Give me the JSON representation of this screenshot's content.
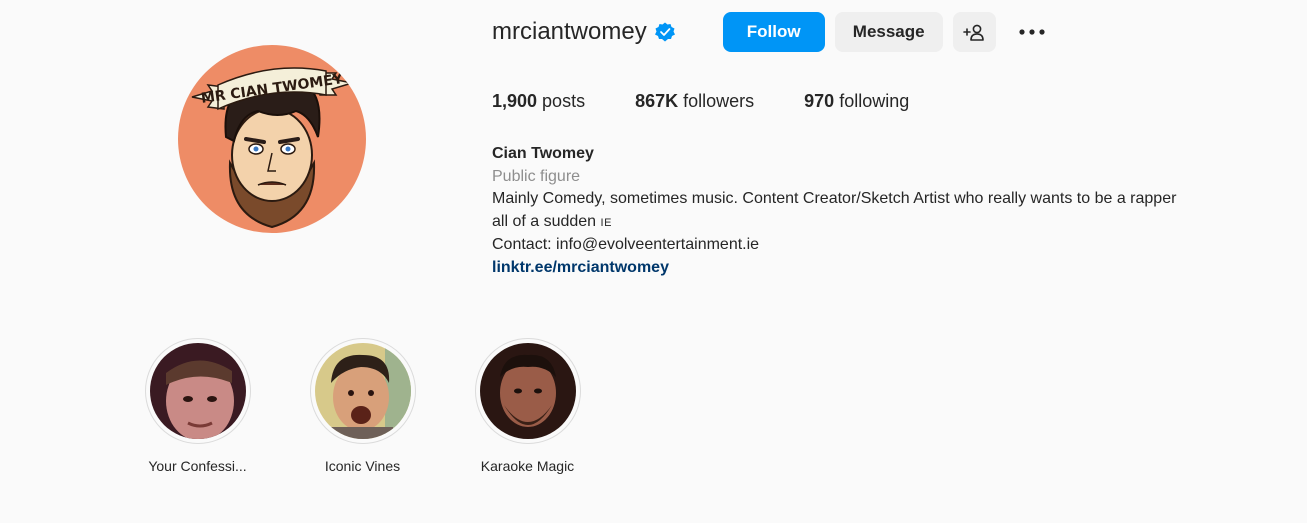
{
  "profile": {
    "username": "mrciantwomey",
    "verified": true,
    "avatar_banner_text": "MR CIAN TWOMEY"
  },
  "actions": {
    "follow_label": "Follow",
    "message_label": "Message",
    "suggest_glyph": "+♙",
    "more_glyph": "•••"
  },
  "stats": {
    "posts_count": "1,900",
    "posts_label": " posts",
    "followers_count": "867K",
    "followers_label": " followers",
    "following_count": "970",
    "following_label": " following"
  },
  "bio": {
    "name": "Cian Twomey",
    "category": "Public figure",
    "text_line1": "Mainly Comedy, sometimes music. Content Creator/Sketch Artist who really wants to be a rapper",
    "text_line2": "all of a sudden ",
    "flag_text": "IE",
    "contact": "Contact: info@evolveentertainment.ie",
    "link": "linktr.ee/mrciantwomey"
  },
  "highlights": [
    {
      "label": "Your Confessi..."
    },
    {
      "label": "Iconic Vines"
    },
    {
      "label": "Karaoke Magic"
    }
  ],
  "colors": {
    "accent": "#0095f6",
    "background": "#fafafa",
    "avatar_bg": "#f0916a",
    "link": "#00376b"
  }
}
